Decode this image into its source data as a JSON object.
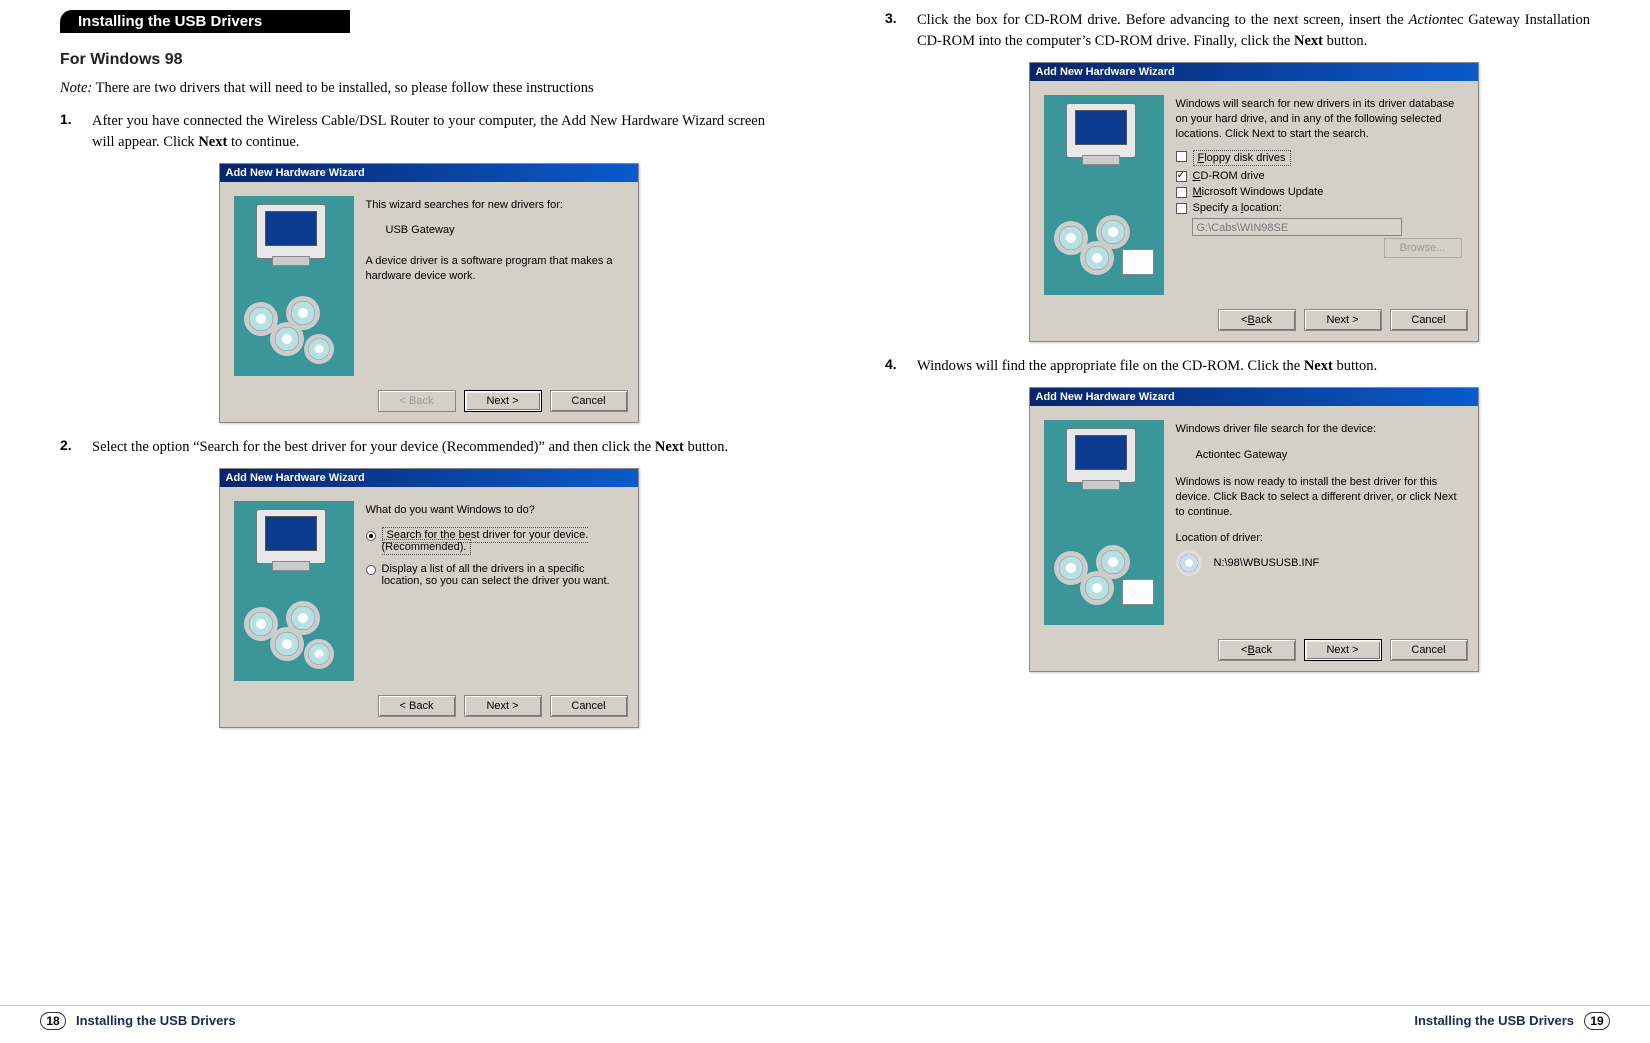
{
  "left": {
    "section_title": "Installing the USB Drivers",
    "subhead": "For Windows 98",
    "note_label": "Note:",
    "note_body": " There are two drivers that will need to be installed, so please follow these instructions",
    "steps": [
      {
        "num": "1.",
        "text_a": "After you have connected the Wireless Cable/DSL Router to your computer, the Add New Hardware Wizard screen will appear. Click ",
        "bold": "Next",
        "text_b": " to continue."
      },
      {
        "num": "2.",
        "text_a": "Select the option “Search for the best driver for your device (Recommended)” and then click the ",
        "bold": "Next",
        "text_b": " button."
      }
    ],
    "dialog1": {
      "title": "Add New Hardware Wizard",
      "line1": "This wizard searches for new drivers for:",
      "device": "USB Gateway",
      "desc": "A device driver is a software program that makes a hardware device work.",
      "back": "< Back",
      "next": "Next >",
      "cancel": "Cancel"
    },
    "dialog2": {
      "title": "Add New Hardware Wizard",
      "prompt": "What do you want Windows to do?",
      "opt1a": "Search for the best driver for your device.",
      "opt1b": "(Recommended).",
      "opt2": "Display a list of all the drivers in a specific location, so you can select the driver you want.",
      "back": "< Back",
      "next": "Next >",
      "cancel": "Cancel"
    },
    "footer_num": "18",
    "footer_label": "Installing the USB Drivers"
  },
  "right": {
    "steps": [
      {
        "num": "3.",
        "text_a": "Click the box for CD-ROM drive. Before advancing to the next screen, insert the ",
        "ital": "Action",
        "text_mid": "tec Gateway Installation CD-ROM into the computer’s CD-ROM drive. Finally, click the ",
        "bold": "Next",
        "text_b": " button."
      },
      {
        "num": "4.",
        "text_a": "Windows will find the appropriate file on the CD-ROM. Click the ",
        "bold": "Next",
        "text_b": " button."
      }
    ],
    "dialog3": {
      "title": "Add New Hardware Wizard",
      "intro": "Windows will search for new drivers in its driver database on your hard drive, and in any of the following selected locations. Click Next to start the search.",
      "opt_floppy_pre": "F",
      "opt_floppy_rest": "loppy disk drives",
      "opt_cd_pre": "C",
      "opt_cd_rest": "D-ROM drive",
      "opt_win_pre": "M",
      "opt_win_rest": "icrosoft Windows Update",
      "opt_loc_a": "Specify a ",
      "opt_loc_u": "l",
      "opt_loc_b": "ocation:",
      "loc_value": "G:\\Cabs\\WIN98SE",
      "browse": "Browse...",
      "back_pre": "< ",
      "back_u": "B",
      "back_rest": "ack",
      "next": "Next >",
      "cancel": "Cancel"
    },
    "dialog4": {
      "title": "Add New Hardware Wizard",
      "line1": "Windows driver file search for the device:",
      "device": "Actiontec Gateway",
      "desc": "Windows is now ready to install the best driver for this device. Click Back to select a different driver, or click Next to continue.",
      "loc_label": "Location of driver:",
      "loc_value": "N:\\98\\WBUSUSB.INF",
      "back_pre": "< ",
      "back_u": "B",
      "back_rest": "ack",
      "next": "Next >",
      "cancel": "Cancel"
    },
    "footer_num": "19",
    "footer_label": "Installing the USB Drivers"
  }
}
